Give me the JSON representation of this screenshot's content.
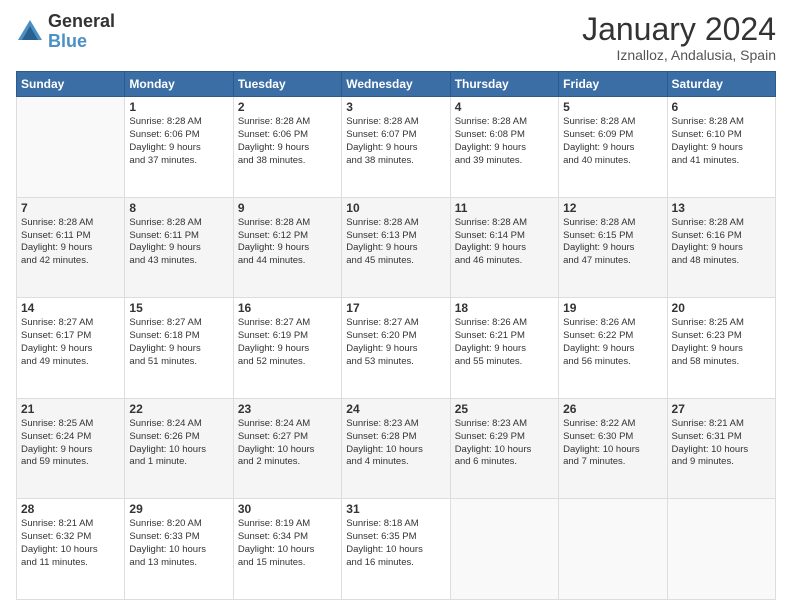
{
  "logo": {
    "general": "General",
    "blue": "Blue"
  },
  "header": {
    "title": "January 2024",
    "subtitle": "Iznalloz, Andalusia, Spain"
  },
  "calendar": {
    "days_of_week": [
      "Sunday",
      "Monday",
      "Tuesday",
      "Wednesday",
      "Thursday",
      "Friday",
      "Saturday"
    ],
    "weeks": [
      [
        {
          "day": "",
          "info": ""
        },
        {
          "day": "1",
          "info": "Sunrise: 8:28 AM\nSunset: 6:06 PM\nDaylight: 9 hours\nand 37 minutes."
        },
        {
          "day": "2",
          "info": "Sunrise: 8:28 AM\nSunset: 6:06 PM\nDaylight: 9 hours\nand 38 minutes."
        },
        {
          "day": "3",
          "info": "Sunrise: 8:28 AM\nSunset: 6:07 PM\nDaylight: 9 hours\nand 38 minutes."
        },
        {
          "day": "4",
          "info": "Sunrise: 8:28 AM\nSunset: 6:08 PM\nDaylight: 9 hours\nand 39 minutes."
        },
        {
          "day": "5",
          "info": "Sunrise: 8:28 AM\nSunset: 6:09 PM\nDaylight: 9 hours\nand 40 minutes."
        },
        {
          "day": "6",
          "info": "Sunrise: 8:28 AM\nSunset: 6:10 PM\nDaylight: 9 hours\nand 41 minutes."
        }
      ],
      [
        {
          "day": "7",
          "info": "Sunrise: 8:28 AM\nSunset: 6:11 PM\nDaylight: 9 hours\nand 42 minutes."
        },
        {
          "day": "8",
          "info": "Sunrise: 8:28 AM\nSunset: 6:11 PM\nDaylight: 9 hours\nand 43 minutes."
        },
        {
          "day": "9",
          "info": "Sunrise: 8:28 AM\nSunset: 6:12 PM\nDaylight: 9 hours\nand 44 minutes."
        },
        {
          "day": "10",
          "info": "Sunrise: 8:28 AM\nSunset: 6:13 PM\nDaylight: 9 hours\nand 45 minutes."
        },
        {
          "day": "11",
          "info": "Sunrise: 8:28 AM\nSunset: 6:14 PM\nDaylight: 9 hours\nand 46 minutes."
        },
        {
          "day": "12",
          "info": "Sunrise: 8:28 AM\nSunset: 6:15 PM\nDaylight: 9 hours\nand 47 minutes."
        },
        {
          "day": "13",
          "info": "Sunrise: 8:28 AM\nSunset: 6:16 PM\nDaylight: 9 hours\nand 48 minutes."
        }
      ],
      [
        {
          "day": "14",
          "info": "Sunrise: 8:27 AM\nSunset: 6:17 PM\nDaylight: 9 hours\nand 49 minutes."
        },
        {
          "day": "15",
          "info": "Sunrise: 8:27 AM\nSunset: 6:18 PM\nDaylight: 9 hours\nand 51 minutes."
        },
        {
          "day": "16",
          "info": "Sunrise: 8:27 AM\nSunset: 6:19 PM\nDaylight: 9 hours\nand 52 minutes."
        },
        {
          "day": "17",
          "info": "Sunrise: 8:27 AM\nSunset: 6:20 PM\nDaylight: 9 hours\nand 53 minutes."
        },
        {
          "day": "18",
          "info": "Sunrise: 8:26 AM\nSunset: 6:21 PM\nDaylight: 9 hours\nand 55 minutes."
        },
        {
          "day": "19",
          "info": "Sunrise: 8:26 AM\nSunset: 6:22 PM\nDaylight: 9 hours\nand 56 minutes."
        },
        {
          "day": "20",
          "info": "Sunrise: 8:25 AM\nSunset: 6:23 PM\nDaylight: 9 hours\nand 58 minutes."
        }
      ],
      [
        {
          "day": "21",
          "info": "Sunrise: 8:25 AM\nSunset: 6:24 PM\nDaylight: 9 hours\nand 59 minutes."
        },
        {
          "day": "22",
          "info": "Sunrise: 8:24 AM\nSunset: 6:26 PM\nDaylight: 10 hours\nand 1 minute."
        },
        {
          "day": "23",
          "info": "Sunrise: 8:24 AM\nSunset: 6:27 PM\nDaylight: 10 hours\nand 2 minutes."
        },
        {
          "day": "24",
          "info": "Sunrise: 8:23 AM\nSunset: 6:28 PM\nDaylight: 10 hours\nand 4 minutes."
        },
        {
          "day": "25",
          "info": "Sunrise: 8:23 AM\nSunset: 6:29 PM\nDaylight: 10 hours\nand 6 minutes."
        },
        {
          "day": "26",
          "info": "Sunrise: 8:22 AM\nSunset: 6:30 PM\nDaylight: 10 hours\nand 7 minutes."
        },
        {
          "day": "27",
          "info": "Sunrise: 8:21 AM\nSunset: 6:31 PM\nDaylight: 10 hours\nand 9 minutes."
        }
      ],
      [
        {
          "day": "28",
          "info": "Sunrise: 8:21 AM\nSunset: 6:32 PM\nDaylight: 10 hours\nand 11 minutes."
        },
        {
          "day": "29",
          "info": "Sunrise: 8:20 AM\nSunset: 6:33 PM\nDaylight: 10 hours\nand 13 minutes."
        },
        {
          "day": "30",
          "info": "Sunrise: 8:19 AM\nSunset: 6:34 PM\nDaylight: 10 hours\nand 15 minutes."
        },
        {
          "day": "31",
          "info": "Sunrise: 8:18 AM\nSunset: 6:35 PM\nDaylight: 10 hours\nand 16 minutes."
        },
        {
          "day": "",
          "info": ""
        },
        {
          "day": "",
          "info": ""
        },
        {
          "day": "",
          "info": ""
        }
      ]
    ]
  }
}
